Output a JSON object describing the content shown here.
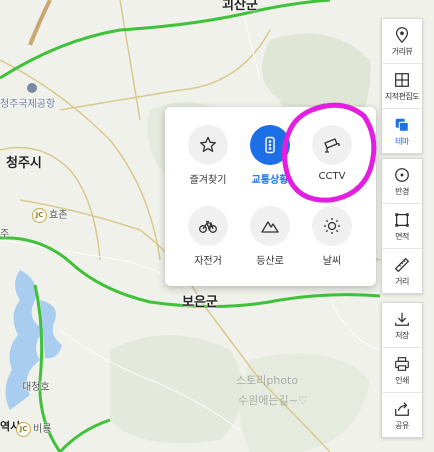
{
  "map": {
    "labels": {
      "top_city": "괴산군",
      "airport": "청주국제공항",
      "cheongju": "청주시",
      "hyochon": "효촌",
      "jc_badge": "JC",
      "boeun": "보은군",
      "daecheong": "대청호",
      "biryong": "비룡",
      "left_cut": "역시",
      "left_cut2": "주"
    },
    "watermark": [
      "스토리photo",
      "수원에는길~♡"
    ]
  },
  "toolbar": {
    "group1": [
      {
        "label": "거리뷰",
        "icon": "location-pin-icon"
      },
      {
        "label": "지적편집도",
        "icon": "cadastral-map-icon"
      },
      {
        "label": "테마",
        "icon": "layers-icon",
        "active": true
      }
    ],
    "group2": [
      {
        "label": "반경",
        "icon": "radius-icon"
      },
      {
        "label": "면적",
        "icon": "area-icon"
      },
      {
        "label": "거리",
        "icon": "ruler-icon"
      }
    ],
    "group3": [
      {
        "label": "저장",
        "icon": "download-icon"
      },
      {
        "label": "인쇄",
        "icon": "print-icon"
      },
      {
        "label": "공유",
        "icon": "share-icon"
      }
    ]
  },
  "layer_panel": {
    "items": [
      {
        "label": "즐겨찾기",
        "icon": "star-icon",
        "on": false
      },
      {
        "label": "교통상황",
        "icon": "traffic-light-icon",
        "on": true
      },
      {
        "label": "CCTV",
        "icon": "cctv-camera-icon",
        "on": false
      },
      {
        "label": "자전거",
        "icon": "bicycle-icon",
        "on": false
      },
      {
        "label": "등산로",
        "icon": "mountain-icon",
        "on": false
      },
      {
        "label": "날씨",
        "icon": "sun-icon",
        "on": false
      }
    ]
  },
  "colors": {
    "accent": "#1c6fe6",
    "highway": "#3fc13a",
    "water": "#a9cdef",
    "annotation": "#e21ee0"
  }
}
